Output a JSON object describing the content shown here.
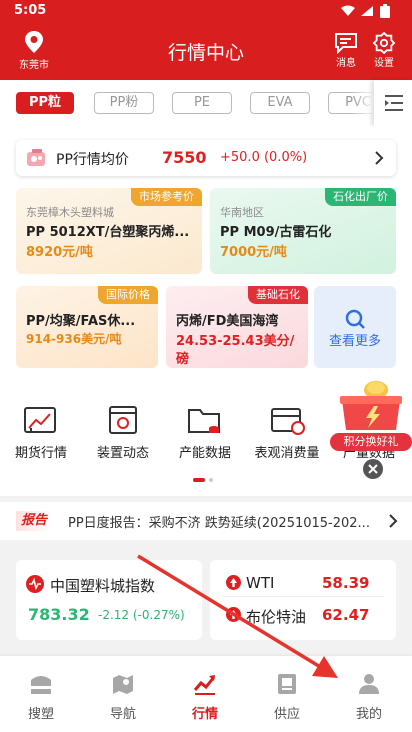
{
  "status": {
    "time": "5:05"
  },
  "header": {
    "city": "东莞市",
    "title": "行情中心",
    "message_label": "消息",
    "settings_label": "设置"
  },
  "tabs": [
    {
      "label": "PP粒",
      "active": true
    },
    {
      "label": "PP粉",
      "active": false
    },
    {
      "label": "PE",
      "active": false
    },
    {
      "label": "EVA",
      "active": false
    },
    {
      "label": "PVC",
      "active": false
    }
  ],
  "avg_price": {
    "label": "PP行情均价",
    "value": "7550",
    "change": "+50.0 (0.0%)"
  },
  "cards": [
    {
      "tag": "市场参考价",
      "subtitle": "东莞樟木头塑料城",
      "name": "PP 5012XT/台塑聚丙烯...",
      "price": "8920元/吨"
    },
    {
      "tag": "石化出厂价",
      "subtitle": "华南地区",
      "name": "PP M09/古雷石化",
      "price": "7000元/吨"
    },
    {
      "tag": "国际价格",
      "name": "PP/均聚/FAS休...",
      "price": "914-936美元/吨"
    },
    {
      "tag": "基础石化",
      "name": "丙烯/FD美国海湾",
      "price_line1": "24.53-25.43美分/",
      "price_line2": "磅"
    }
  ],
  "more": {
    "label": "查看更多"
  },
  "quick_links": [
    {
      "label": "期货行情",
      "icon": "futures-chart-icon"
    },
    {
      "label": "装置动态",
      "icon": "device-dynamics-icon"
    },
    {
      "label": "产能数据",
      "icon": "capacity-folder-icon"
    },
    {
      "label": "表观消费量",
      "icon": "consumption-chart-icon"
    },
    {
      "label": "产量数据",
      "icon": "output-data-icon"
    }
  ],
  "promo": {
    "label": "积分换好礼"
  },
  "report": {
    "badge": "报告",
    "text": "PP日度报告：采购不济 跌势延续(20251015-202..."
  },
  "index": {
    "name": "中国塑料城指数",
    "value": "783.32",
    "change": "-2.12 (-0.27%)"
  },
  "oil": [
    {
      "name": "WTI",
      "value": "58.39"
    },
    {
      "name": "布伦特油",
      "value": "62.47"
    }
  ],
  "nav": [
    {
      "label": "搜塑",
      "active": false
    },
    {
      "label": "导航",
      "active": false
    },
    {
      "label": "行情",
      "active": true
    },
    {
      "label": "供应",
      "active": false
    },
    {
      "label": "我的",
      "active": false
    }
  ],
  "colors": {
    "brand_red": "#d81e1e",
    "price_red": "#e02020",
    "orange": "#e88a12",
    "green": "#2bb673"
  }
}
